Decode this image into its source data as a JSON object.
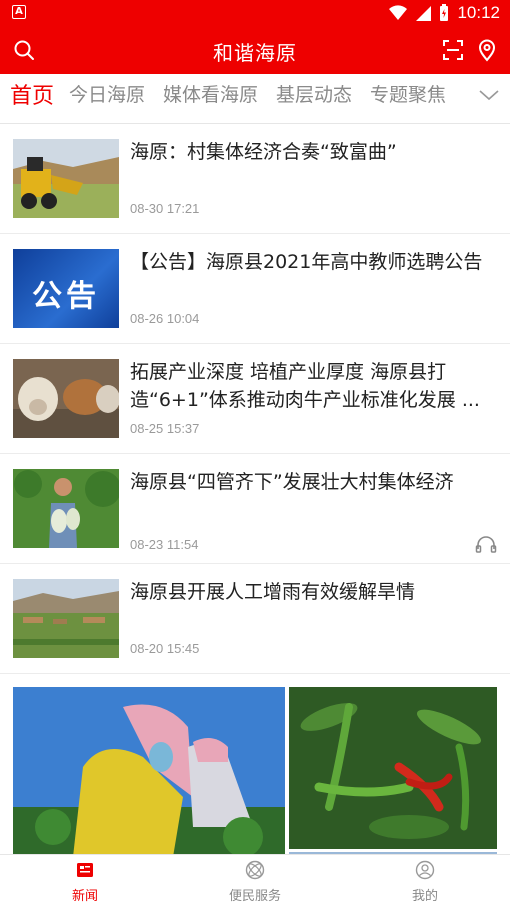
{
  "status_bar": {
    "time": "10:12",
    "app_badge": "A"
  },
  "app_bar": {
    "title": "和谐海原"
  },
  "tabs": [
    {
      "label": "首页",
      "active": true
    },
    {
      "label": "今日海原",
      "active": false
    },
    {
      "label": "媒体看海原",
      "active": false
    },
    {
      "label": "基层动态",
      "active": false
    },
    {
      "label": "专题聚焦",
      "active": false
    }
  ],
  "news": [
    {
      "title": "海原：村集体经济合奏“致富曲”",
      "date": "08-30 17:21"
    },
    {
      "title": "【公告】海原县2021年高中教师选聘公告",
      "date": "08-26 10:04",
      "thumb_text": "公告"
    },
    {
      "title": " 拓展产业深度 培植产业厚度 海原县打造“6+1”体系推动肉牛产业标准化发展 ...",
      "date": "08-25 15:37"
    },
    {
      "title": "海原县“四管齐下”发展壮大村集体经济",
      "date": "08-23 11:54",
      "has_audio": true
    },
    {
      "title": "海原县开展人工增雨有效缓解旱情",
      "date": "08-20 15:45"
    }
  ],
  "bottom_nav": [
    {
      "label": "新闻",
      "active": true,
      "icon": "news-icon"
    },
    {
      "label": "便民服务",
      "active": false,
      "icon": "service-icon"
    },
    {
      "label": "我的",
      "active": false,
      "icon": "profile-icon"
    }
  ],
  "colors": {
    "brand": "#ee0000",
    "muted": "#8a8a8a",
    "date": "#9a9a9a"
  }
}
